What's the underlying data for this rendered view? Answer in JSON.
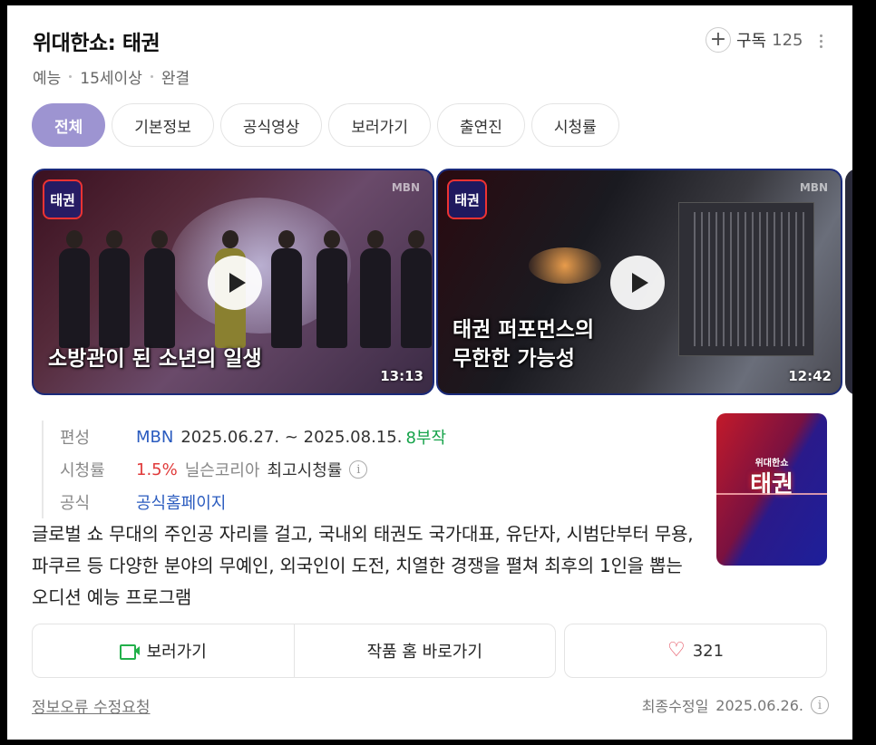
{
  "header": {
    "title": "위대한쇼: 태권",
    "meta": [
      "예능",
      "15세이상",
      "완결"
    ],
    "subscribe_label": "구독",
    "subscribe_count": "125"
  },
  "tabs": [
    {
      "label": "전체",
      "active": true
    },
    {
      "label": "기본정보",
      "active": false
    },
    {
      "label": "공식영상",
      "active": false
    },
    {
      "label": "보러가기",
      "active": false
    },
    {
      "label": "출연진",
      "active": false
    },
    {
      "label": "시청률",
      "active": false
    }
  ],
  "videos": [
    {
      "logo": "태권",
      "brand": "MBN",
      "caption": "소방관이 된 소년의 일생",
      "duration": "13:13"
    },
    {
      "logo": "태권",
      "brand": "MBN",
      "caption_line1": "태권 퍼포먼스의",
      "caption_line2": "무한한 가능성",
      "duration": "12:42"
    }
  ],
  "info": {
    "broadcast_label": "편성",
    "channel": "MBN",
    "period": "2025.06.27. ~ 2025.08.15.",
    "episodes": "8부작",
    "rating_label": "시청률",
    "rating_value": "1.5%",
    "rating_source": "닐슨코리아",
    "rating_note": "최고시청률",
    "official_label": "공식",
    "official_link": "공식홈페이지"
  },
  "poster": {
    "small_title": "위대한쇼",
    "title": "태권"
  },
  "description": "글로벌 쇼 무대의 주인공 자리를 걸고, 국내외 태권도 국가대표, 유단자, 시범단부터 무용, 파쿠르 등 다양한 분야의 무예인, 외국인이 도전, 치열한 경쟁을 펼쳐 최후의 1인을 뽑는 오디션 예능 프로그램",
  "actions": {
    "watch_label": "보러가기",
    "home_label": "작품 홈 바로가기",
    "like_count": "321"
  },
  "footer": {
    "report_label": "정보오류 수정요청",
    "updated_label": "최종수정일",
    "updated_date": "2025.06.26."
  },
  "colors": {
    "accent_tab": "#9d94d1",
    "link_blue": "#2a5bbf",
    "episodes_green": "#16a34a",
    "rating_red": "#e03a3a",
    "watch_icon_green": "#22b04a",
    "heart_red": "#e34a5a"
  }
}
